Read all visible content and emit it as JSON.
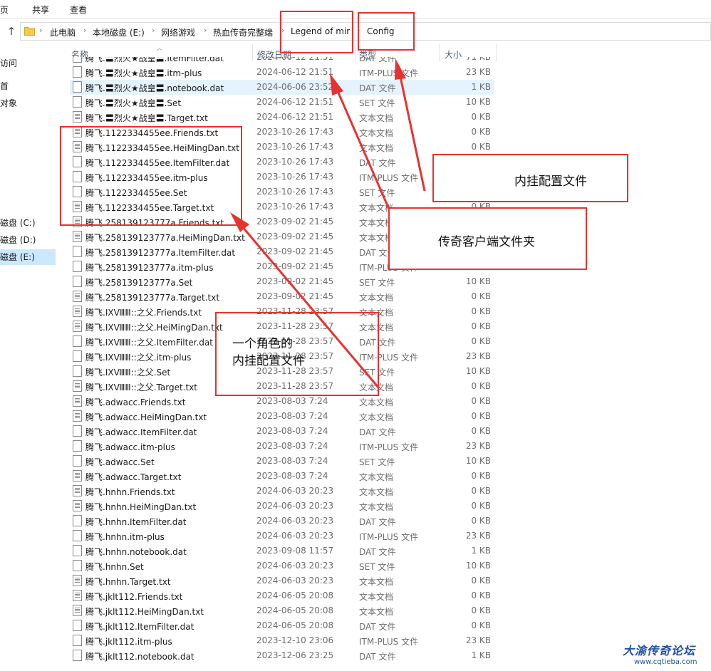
{
  "ribbon": {
    "tabs": [
      "主页",
      "共享",
      "查看"
    ]
  },
  "address": {
    "crumbs": [
      "此电脑",
      "本地磁盘 (E:)",
      "网络游戏",
      "热血传奇完整端",
      "Legend of mir",
      "Config"
    ]
  },
  "nav": {
    "items": [
      "访问",
      "首",
      "对象",
      "磁盘 (C:)",
      "磁盘 (D:)",
      "磁盘 (E:)"
    ]
  },
  "columns": {
    "name": "名称",
    "date": "修改日期",
    "type": "类型",
    "size": "大小"
  },
  "files": [
    {
      "name": "腾飞.〓烈火★战皇〓.ItemFilter.dat",
      "date": "2024-06-12 21:51",
      "type": "DAT 文件",
      "size": "71 KB",
      "icon": "file"
    },
    {
      "name": "腾飞.〓烈火★战皇〓.itm-plus",
      "date": "2024-06-12 21:51",
      "type": "ITM-PLUS 文件",
      "size": "23 KB",
      "icon": "file"
    },
    {
      "name": "腾飞.〓烈火★战皇〓.notebook.dat",
      "date": "2024-06-06 23:52",
      "type": "DAT 文件",
      "size": "1 KB",
      "icon": "file",
      "selected": true
    },
    {
      "name": "腾飞.〓烈火★战皇〓.Set",
      "date": "2024-06-12 21:51",
      "type": "SET 文件",
      "size": "10 KB",
      "icon": "file"
    },
    {
      "name": "腾飞.〓烈火★战皇〓.Target.txt",
      "date": "2024-06-12 21:51",
      "type": "文本文档",
      "size": "0 KB",
      "icon": "txt"
    },
    {
      "name": "腾飞.1122334455ee.Friends.txt",
      "date": "2023-10-26 17:43",
      "type": "文本文档",
      "size": "0 KB",
      "icon": "txt"
    },
    {
      "name": "腾飞.1122334455ee.HeiMingDan.txt",
      "date": "2023-10-26 17:43",
      "type": "文本文档",
      "size": "0 KB",
      "icon": "txt"
    },
    {
      "name": "腾飞.1122334455ee.ItemFilter.dat",
      "date": "2023-10-26 17:43",
      "type": "DAT 文件",
      "size": "0 KB",
      "icon": "file"
    },
    {
      "name": "腾飞.1122334455ee.itm-plus",
      "date": "2023-10-26 17:43",
      "type": "ITM-PLUS 文件",
      "size": "23 KB",
      "icon": "file"
    },
    {
      "name": "腾飞.1122334455ee.Set",
      "date": "2023-10-26 17:43",
      "type": "SET 文件",
      "size": "10 KB",
      "icon": "file"
    },
    {
      "name": "腾飞.1122334455ee.Target.txt",
      "date": "2023-10-26 17:43",
      "type": "文本文档",
      "size": "0 KB",
      "icon": "txt"
    },
    {
      "name": "腾飞.258139123777a.Friends.txt",
      "date": "2023-09-02 21:45",
      "type": "文本文档",
      "size": "0 KB",
      "icon": "txt"
    },
    {
      "name": "腾飞.258139123777a.HeiMingDan.txt",
      "date": "2023-09-02 21:45",
      "type": "文本文档",
      "size": "0 KB",
      "icon": "txt"
    },
    {
      "name": "腾飞.258139123777a.ItemFilter.dat",
      "date": "2023-09-02 21:45",
      "type": "DAT 文件",
      "size": "0 KB",
      "icon": "file"
    },
    {
      "name": "腾飞.258139123777a.itm-plus",
      "date": "2023-09-02 21:45",
      "type": "ITM-PLUS 文件",
      "size": "23 KB",
      "icon": "file"
    },
    {
      "name": "腾飞.258139123777a.Set",
      "date": "2023-09-02 21:45",
      "type": "SET 文件",
      "size": "10 KB",
      "icon": "file"
    },
    {
      "name": "腾飞.258139123777a.Target.txt",
      "date": "2023-09-02 21:45",
      "type": "文本文档",
      "size": "0 KB",
      "icon": "txt"
    },
    {
      "name": "腾飞.ⅠⅩⅧⅢ::之父.Friends.txt",
      "date": "2023-11-28 23:57",
      "type": "文本文档",
      "size": "0 KB",
      "icon": "txt"
    },
    {
      "name": "腾飞.ⅠⅩⅧⅢ::之父.HeiMingDan.txt",
      "date": "2023-11-28 23:57",
      "type": "文本文档",
      "size": "0 KB",
      "icon": "txt"
    },
    {
      "name": "腾飞.ⅠⅩⅧⅢ::之父.ItemFilter.dat",
      "date": "2023-11-28 23:57",
      "type": "DAT 文件",
      "size": "0 KB",
      "icon": "file"
    },
    {
      "name": "腾飞.ⅠⅩⅧⅢ::之父.itm-plus",
      "date": "2023-11-28 23:57",
      "type": "ITM-PLUS 文件",
      "size": "23 KB",
      "icon": "file"
    },
    {
      "name": "腾飞.ⅠⅩⅧⅢ::之父.Set",
      "date": "2023-11-28 23:57",
      "type": "SET 文件",
      "size": "10 KB",
      "icon": "file"
    },
    {
      "name": "腾飞.ⅠⅩⅧⅢ::之父.Target.txt",
      "date": "2023-11-28 23:57",
      "type": "文本文档",
      "size": "0 KB",
      "icon": "txt"
    },
    {
      "name": "腾飞.adwacc.Friends.txt",
      "date": "2023-08-03 7:24",
      "type": "文本文档",
      "size": "0 KB",
      "icon": "txt"
    },
    {
      "name": "腾飞.adwacc.HeiMingDan.txt",
      "date": "2023-08-03 7:24",
      "type": "文本文档",
      "size": "0 KB",
      "icon": "txt"
    },
    {
      "name": "腾飞.adwacc.ItemFilter.dat",
      "date": "2023-08-03 7:24",
      "type": "DAT 文件",
      "size": "0 KB",
      "icon": "file"
    },
    {
      "name": "腾飞.adwacc.itm-plus",
      "date": "2023-08-03 7:24",
      "type": "ITM-PLUS 文件",
      "size": "23 KB",
      "icon": "file"
    },
    {
      "name": "腾飞.adwacc.Set",
      "date": "2023-08-03 7:24",
      "type": "SET 文件",
      "size": "10 KB",
      "icon": "file"
    },
    {
      "name": "腾飞.adwacc.Target.txt",
      "date": "2023-08-03 7:24",
      "type": "文本文档",
      "size": "0 KB",
      "icon": "txt"
    },
    {
      "name": "腾飞.hnhn.Friends.txt",
      "date": "2024-06-03 20:23",
      "type": "文本文档",
      "size": "0 KB",
      "icon": "txt"
    },
    {
      "name": "腾飞.hnhn.HeiMingDan.txt",
      "date": "2024-06-03 20:23",
      "type": "文本文档",
      "size": "0 KB",
      "icon": "txt"
    },
    {
      "name": "腾飞.hnhn.ItemFilter.dat",
      "date": "2024-06-03 20:23",
      "type": "DAT 文件",
      "size": "0 KB",
      "icon": "file"
    },
    {
      "name": "腾飞.hnhn.itm-plus",
      "date": "2024-06-03 20:23",
      "type": "ITM-PLUS 文件",
      "size": "23 KB",
      "icon": "file"
    },
    {
      "name": "腾飞.hnhn.notebook.dat",
      "date": "2023-09-08 11:57",
      "type": "DAT 文件",
      "size": "1 KB",
      "icon": "file"
    },
    {
      "name": "腾飞.hnhn.Set",
      "date": "2024-06-03 20:23",
      "type": "SET 文件",
      "size": "10 KB",
      "icon": "file"
    },
    {
      "name": "腾飞.hnhn.Target.txt",
      "date": "2024-06-03 20:23",
      "type": "文本文档",
      "size": "0 KB",
      "icon": "txt"
    },
    {
      "name": "腾飞.jklt112.Friends.txt",
      "date": "2024-06-05 20:08",
      "type": "文本文档",
      "size": "0 KB",
      "icon": "txt"
    },
    {
      "name": "腾飞.jklt112.HeiMingDan.txt",
      "date": "2024-06-05 20:08",
      "type": "文本文档",
      "size": "0 KB",
      "icon": "txt"
    },
    {
      "name": "腾飞.jklt112.ItemFilter.dat",
      "date": "2024-06-05 20:08",
      "type": "DAT 文件",
      "size": "0 KB",
      "icon": "file"
    },
    {
      "name": "腾飞.jklt112.itm-plus",
      "date": "2023-12-10 23:06",
      "type": "ITM-PLUS 文件",
      "size": "23 KB",
      "icon": "file"
    },
    {
      "name": "腾飞.jklt112.notebook.dat",
      "date": "2023-12-06 23:25",
      "type": "DAT 文件",
      "size": "1 KB",
      "icon": "file"
    }
  ],
  "annotations": {
    "plugin_config": "内挂配置文件",
    "client_folder": "传奇客户端文件夹",
    "role_line1": "一个角色的",
    "role_line2": "内挂配置文件",
    "color": "#e8322f"
  },
  "watermark": {
    "title": "大渝传奇论坛",
    "url": "www.cqtieba.com"
  }
}
